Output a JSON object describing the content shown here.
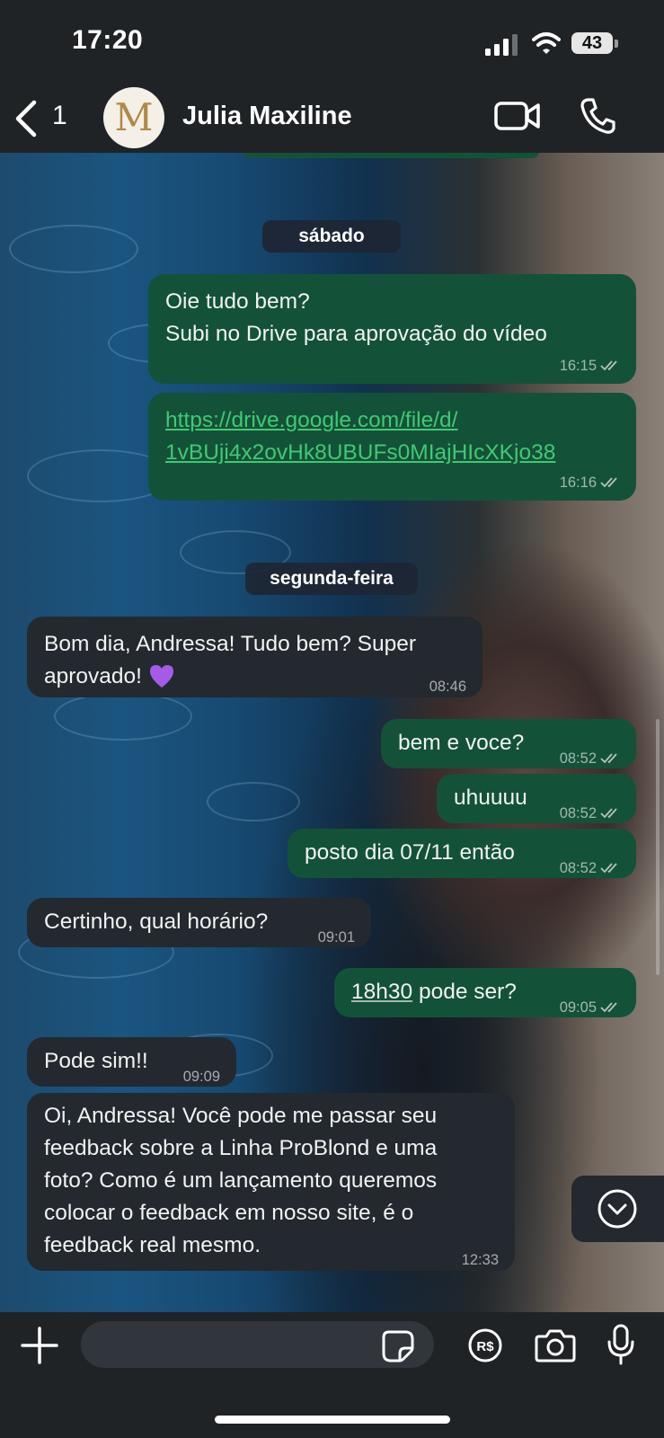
{
  "status_bar": {
    "time": "17:20",
    "battery": "43"
  },
  "header": {
    "back_count": "1",
    "avatar_letter": "M",
    "contact_name": "Julia Maxiline"
  },
  "day_labels": {
    "saturday": "sábado",
    "monday": "segunda-feira"
  },
  "messages": [
    {
      "dir": "out",
      "text": "Oie tudo bem?\nSubi no Drive para aprovação do vídeo",
      "time": "16:15",
      "read": true
    },
    {
      "dir": "out",
      "link_line1": "https://drive.google.com/file/d/",
      "link_line2": "1vBUji4x2ovHk8UBUFs0MIajHIcXKjo38",
      "time": "16:16",
      "read": true
    },
    {
      "dir": "in",
      "text": "Bom dia, Andressa! Tudo bem? Super\naprovado!",
      "emoji": "purple-heart",
      "time": "08:46"
    },
    {
      "dir": "out",
      "text": "bem e voce?",
      "time": "08:52",
      "read": true
    },
    {
      "dir": "out",
      "text": "uhuuuu",
      "time": "08:52",
      "read": true
    },
    {
      "dir": "out",
      "text": "posto dia 07/11 então",
      "time": "08:52",
      "read": true
    },
    {
      "dir": "in",
      "text": "Certinho, qual horário?",
      "time": "09:01"
    },
    {
      "dir": "out",
      "text_time": "18h30",
      "text_rest": " pode ser?",
      "time": "09:05",
      "read": true
    },
    {
      "dir": "in",
      "text": "Pode sim!!",
      "time": "09:09"
    },
    {
      "dir": "in",
      "text": "Oi, Andressa! Você pode me passar seu\nfeedback sobre a Linha ProBlond e uma\nfoto? Como é um lançamento queremos\ncolocar o feedback em nosso site, é o\nfeedback real mesmo.",
      "time": "12:33"
    }
  ],
  "input_bar": {
    "placeholder": ""
  },
  "icons": [
    "back-chevron-icon",
    "video-call-icon",
    "phone-icon",
    "plus-icon",
    "sticker-icon",
    "payment-icon",
    "camera-icon",
    "microphone-icon",
    "scroll-down-icon"
  ],
  "colors": {
    "outgoing_bubble": "#135239",
    "incoming_bubble": "#23292e",
    "link": "#40c973",
    "bar": "#1f2326"
  }
}
